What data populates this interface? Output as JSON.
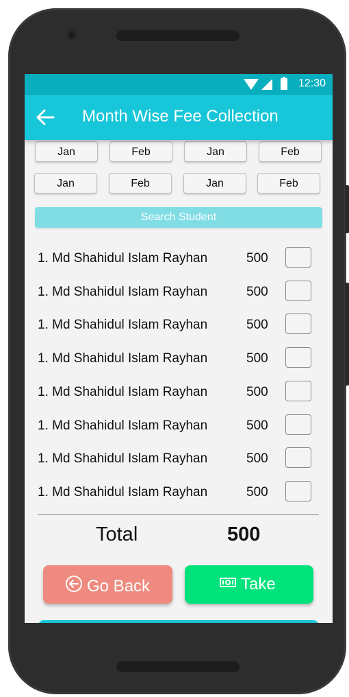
{
  "status_bar": {
    "time": "12:30"
  },
  "app_bar": {
    "title": "Month Wise Fee Collection"
  },
  "months_row1": [
    "Jan",
    "Feb",
    "Jan",
    "Feb"
  ],
  "months_row2": [
    "Jan",
    "Feb",
    "Jan",
    "Feb"
  ],
  "search": {
    "placeholder": "Search Student"
  },
  "students": [
    {
      "name": "1. Md Shahidul Islam Rayhan",
      "amount": "500",
      "checked": false
    },
    {
      "name": "1. Md Shahidul Islam Rayhan",
      "amount": "500",
      "checked": false
    },
    {
      "name": "1. Md Shahidul Islam Rayhan",
      "amount": "500",
      "checked": false
    },
    {
      "name": "1. Md Shahidul Islam Rayhan",
      "amount": "500",
      "checked": false
    },
    {
      "name": "1. Md Shahidul Islam Rayhan",
      "amount": "500",
      "checked": false
    },
    {
      "name": "1. Md Shahidul Islam Rayhan",
      "amount": "500",
      "checked": false
    },
    {
      "name": "1. Md Shahidul Islam Rayhan",
      "amount": "500",
      "checked": false
    },
    {
      "name": "1. Md Shahidul Islam Rayhan",
      "amount": "500",
      "checked": false
    }
  ],
  "total": {
    "label": "Total",
    "value": "500"
  },
  "buttons": {
    "go_back": {
      "label": "Go Back",
      "icon": "circle-arrow-left-icon",
      "color": "#ee8a7f"
    },
    "take": {
      "label": "Take",
      "icon": "money-icon",
      "color": "#00e27a"
    }
  },
  "colors": {
    "primary": "#17c6d8",
    "status_bar": "#0aafbf",
    "search_bg": "#80dde4"
  }
}
